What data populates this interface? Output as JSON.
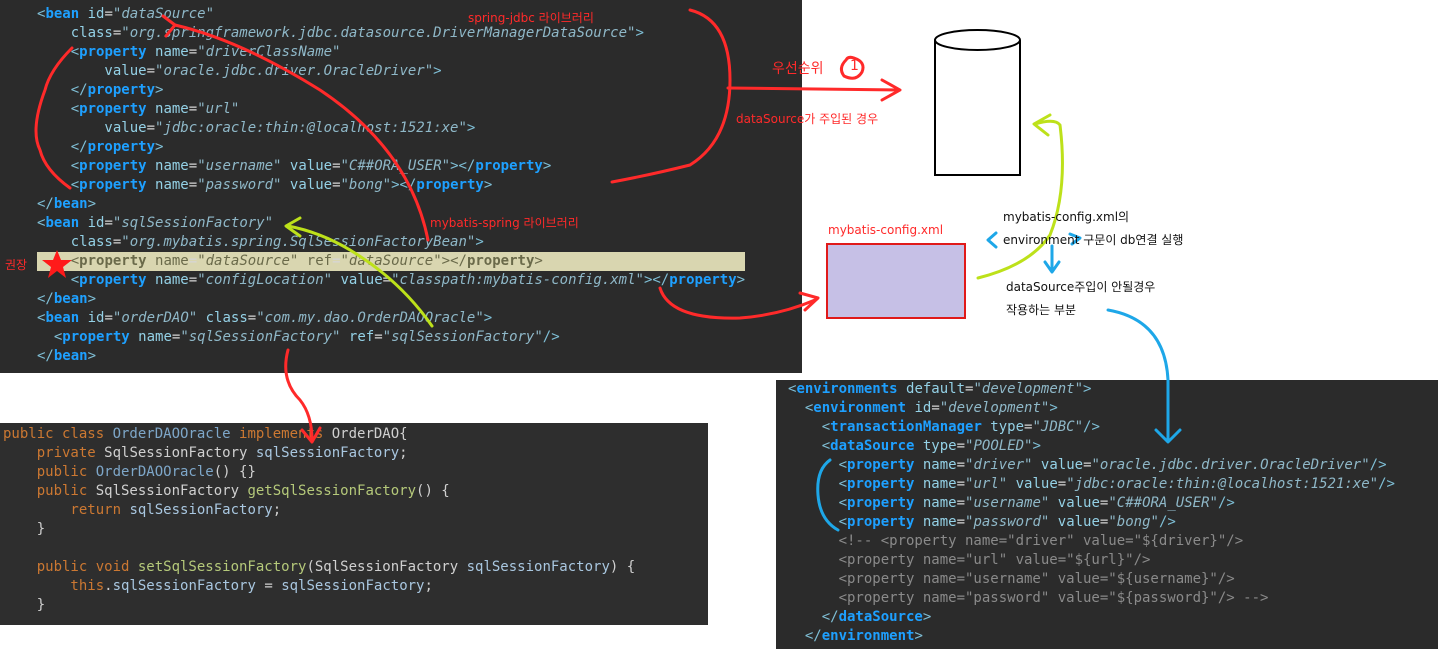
{
  "spring_xml": {
    "lines": [
      [
        [
          "t",
          "<"
        ],
        [
          "k",
          "bean"
        ],
        [
          "a",
          " id"
        ],
        [
          "p",
          "="
        ],
        [
          "v",
          "\"dataSource\""
        ]
      ],
      [
        [
          "a",
          "    class"
        ],
        [
          "p",
          "="
        ],
        [
          "v",
          "\"org.springframework.jdbc.datasource.DriverManagerDataSource\""
        ],
        [
          "t",
          ">"
        ]
      ],
      [
        [
          "t",
          "    <"
        ],
        [
          "k",
          "property"
        ],
        [
          "a",
          " name"
        ],
        [
          "p",
          "="
        ],
        [
          "v",
          "\"driverClassName\""
        ]
      ],
      [
        [
          "a",
          "        value"
        ],
        [
          "p",
          "="
        ],
        [
          "v",
          "\"oracle.jdbc.driver.OracleDriver\""
        ],
        [
          "t",
          ">"
        ]
      ],
      [
        [
          "t",
          "    </"
        ],
        [
          "k",
          "property"
        ],
        [
          "t",
          ">"
        ]
      ],
      [
        [
          "t",
          "    <"
        ],
        [
          "k",
          "property"
        ],
        [
          "a",
          " name"
        ],
        [
          "p",
          "="
        ],
        [
          "v",
          "\"url\""
        ]
      ],
      [
        [
          "a",
          "        value"
        ],
        [
          "p",
          "="
        ],
        [
          "v",
          "\"jdbc:oracle:thin:@localhost:1521:xe\""
        ],
        [
          "t",
          ">"
        ]
      ],
      [
        [
          "t",
          "    </"
        ],
        [
          "k",
          "property"
        ],
        [
          "t",
          ">"
        ]
      ],
      [
        [
          "t",
          "    <"
        ],
        [
          "k",
          "property"
        ],
        [
          "a",
          " name"
        ],
        [
          "p",
          "="
        ],
        [
          "v",
          "\"username\""
        ],
        [
          "a",
          " value"
        ],
        [
          "p",
          "="
        ],
        [
          "v",
          "\"C##ORA_USER\""
        ],
        [
          "t",
          "></"
        ],
        [
          "k",
          "property"
        ],
        [
          "t",
          ">"
        ]
      ],
      [
        [
          "t",
          "    <"
        ],
        [
          "k",
          "property"
        ],
        [
          "a",
          " name"
        ],
        [
          "p",
          "="
        ],
        [
          "v",
          "\"password\""
        ],
        [
          "a",
          " value"
        ],
        [
          "p",
          "="
        ],
        [
          "v",
          "\"bong\""
        ],
        [
          "t",
          "></"
        ],
        [
          "k",
          "property"
        ],
        [
          "t",
          ">"
        ]
      ],
      [
        [
          "t",
          "</"
        ],
        [
          "k",
          "bean"
        ],
        [
          "t",
          ">"
        ]
      ],
      [
        [
          "t",
          "<"
        ],
        [
          "k",
          "bean"
        ],
        [
          "a",
          " id"
        ],
        [
          "p",
          "="
        ],
        [
          "v",
          "\"sqlSessionFactory\""
        ]
      ],
      [
        [
          "a",
          "    class"
        ],
        [
          "p",
          "="
        ],
        [
          "v",
          "\"org.mybatis.spring.SqlSessionFactoryBean\""
        ],
        [
          "t",
          ">"
        ]
      ],
      [
        [
          "t",
          "    <"
        ],
        [
          "k",
          "property"
        ],
        [
          "a",
          " name"
        ],
        [
          "p",
          "="
        ],
        [
          "v",
          "\"dataSource\""
        ],
        [
          "a",
          " ref"
        ],
        [
          "p",
          "="
        ],
        [
          "v",
          "\"dataSource\""
        ],
        [
          "t",
          "></"
        ],
        [
          "k",
          "property"
        ],
        [
          "t",
          ">"
        ]
      ],
      [
        [
          "t",
          "    <"
        ],
        [
          "k",
          "property"
        ],
        [
          "a",
          " name"
        ],
        [
          "p",
          "="
        ],
        [
          "v",
          "\"configLocation\""
        ],
        [
          "a",
          " value"
        ],
        [
          "p",
          "="
        ],
        [
          "v",
          "\"classpath:mybatis-config.xml\""
        ],
        [
          "t",
          "></"
        ],
        [
          "k",
          "property"
        ],
        [
          "t",
          ">"
        ]
      ],
      [
        [
          "t",
          "</"
        ],
        [
          "k",
          "bean"
        ],
        [
          "t",
          ">"
        ]
      ],
      [
        [
          "t",
          "<"
        ],
        [
          "k",
          "bean"
        ],
        [
          "a",
          " id"
        ],
        [
          "p",
          "="
        ],
        [
          "v",
          "\"orderDAO\""
        ],
        [
          "a",
          " class"
        ],
        [
          "p",
          "="
        ],
        [
          "v",
          "\"com.my.dao.OrderDAOOracle\""
        ],
        [
          "t",
          ">"
        ]
      ],
      [
        [
          "t",
          "  <"
        ],
        [
          "k",
          "property"
        ],
        [
          "a",
          " name"
        ],
        [
          "p",
          "="
        ],
        [
          "v",
          "\"sqlSessionFactory\""
        ],
        [
          "a",
          " ref"
        ],
        [
          "p",
          "="
        ],
        [
          "v",
          "\"sqlSessionFactory\""
        ],
        [
          "t",
          "/>"
        ]
      ],
      [
        [
          "t",
          "</"
        ],
        [
          "k",
          "bean"
        ],
        [
          "t",
          ">"
        ]
      ]
    ],
    "highlighted_line": 13
  },
  "java_code": {
    "lines": [
      [
        [
          "jk",
          "public class "
        ],
        [
          "jt",
          "OrderDAOOracle "
        ],
        [
          "jk",
          "implements "
        ],
        [
          "jp",
          "OrderDAO{"
        ]
      ],
      [
        [
          "jk",
          "    private "
        ],
        [
          "jp",
          "SqlSessionFactory "
        ],
        [
          "jv",
          "sqlSessionFactory"
        ],
        [
          "jp",
          ";"
        ]
      ],
      [
        [
          "jk",
          "    public "
        ],
        [
          "jt",
          "OrderDAOOracle"
        ],
        [
          "jp",
          "() {}"
        ]
      ],
      [
        [
          "jk",
          "    public "
        ],
        [
          "jp",
          "SqlSessionFactory "
        ],
        [
          "jm",
          "getSqlSessionFactory"
        ],
        [
          "jp",
          "() {"
        ]
      ],
      [
        [
          "jk",
          "        return "
        ],
        [
          "jv",
          "sqlSessionFactory"
        ],
        [
          "jp",
          ";"
        ]
      ],
      [
        [
          "jp",
          "    }"
        ]
      ],
      [
        [
          "jp",
          " "
        ]
      ],
      [
        [
          "jk",
          "    public void "
        ],
        [
          "jm",
          "setSqlSessionFactory"
        ],
        [
          "jp",
          "(SqlSessionFactory "
        ],
        [
          "jv",
          "sqlSessionFactory"
        ],
        [
          "jp",
          ") {"
        ]
      ],
      [
        [
          "jk",
          "        this"
        ],
        [
          "jp",
          "."
        ],
        [
          "jv",
          "sqlSessionFactory"
        ],
        [
          "jp",
          " = "
        ],
        [
          "jv",
          "sqlSessionFactory"
        ],
        [
          "jp",
          ";"
        ]
      ],
      [
        [
          "jp",
          "    }"
        ]
      ]
    ]
  },
  "mybatis_xml": {
    "lines": [
      [
        [
          "t",
          "<"
        ],
        [
          "k",
          "environments"
        ],
        [
          "a",
          " default"
        ],
        [
          "p",
          "="
        ],
        [
          "v",
          "\"development\""
        ],
        [
          "t",
          ">"
        ]
      ],
      [
        [
          "t",
          "  <"
        ],
        [
          "k",
          "environment"
        ],
        [
          "a",
          " id"
        ],
        [
          "p",
          "="
        ],
        [
          "v",
          "\"development\""
        ],
        [
          "t",
          ">"
        ]
      ],
      [
        [
          "t",
          "    <"
        ],
        [
          "k",
          "transactionManager"
        ],
        [
          "a",
          " type"
        ],
        [
          "p",
          "="
        ],
        [
          "v",
          "\"JDBC\""
        ],
        [
          "t",
          "/>"
        ]
      ],
      [
        [
          "t",
          "    <"
        ],
        [
          "k",
          "dataSource"
        ],
        [
          "a",
          " type"
        ],
        [
          "p",
          "="
        ],
        [
          "v",
          "\"POOLED\""
        ],
        [
          "t",
          ">"
        ]
      ],
      [
        [
          "t",
          "      <"
        ],
        [
          "k",
          "property"
        ],
        [
          "a",
          " name"
        ],
        [
          "p",
          "="
        ],
        [
          "v",
          "\"driver\""
        ],
        [
          "a",
          " value"
        ],
        [
          "p",
          "="
        ],
        [
          "v",
          "\"oracle.jdbc.driver.OracleDriver\""
        ],
        [
          "t",
          "/>"
        ]
      ],
      [
        [
          "t",
          "      <"
        ],
        [
          "k",
          "property"
        ],
        [
          "a",
          " name"
        ],
        [
          "p",
          "="
        ],
        [
          "v",
          "\"url\""
        ],
        [
          "a",
          " value"
        ],
        [
          "p",
          "="
        ],
        [
          "v",
          "\"jdbc:oracle:thin:@localhost:1521:xe\""
        ],
        [
          "t",
          "/>"
        ]
      ],
      [
        [
          "t",
          "      <"
        ],
        [
          "k",
          "property"
        ],
        [
          "a",
          " name"
        ],
        [
          "p",
          "="
        ],
        [
          "v",
          "\"username\""
        ],
        [
          "a",
          " value"
        ],
        [
          "p",
          "="
        ],
        [
          "v",
          "\"C##ORA_USER\""
        ],
        [
          "t",
          "/>"
        ]
      ],
      [
        [
          "t",
          "      <"
        ],
        [
          "k",
          "property"
        ],
        [
          "a",
          " name"
        ],
        [
          "p",
          "="
        ],
        [
          "v",
          "\"password\""
        ],
        [
          "a",
          " value"
        ],
        [
          "p",
          "="
        ],
        [
          "v",
          "\"bong\""
        ],
        [
          "t",
          "/>"
        ]
      ],
      [
        [
          "c",
          "      <!-- <property name=\"driver\" value=\"${driver}\"/>"
        ]
      ],
      [
        [
          "c",
          "      <property name=\"url\" value=\"${url}\"/>"
        ]
      ],
      [
        [
          "c",
          "      <property name=\"username\" value=\"${username}\"/>"
        ]
      ],
      [
        [
          "c",
          "      <property name=\"password\" value=\"${password}\"/> -->"
        ]
      ],
      [
        [
          "t",
          "    </"
        ],
        [
          "k",
          "dataSource"
        ],
        [
          "t",
          ">"
        ]
      ],
      [
        [
          "t",
          "  </"
        ],
        [
          "k",
          "environment"
        ],
        [
          "t",
          ">"
        ]
      ]
    ]
  },
  "annotations": {
    "spring_jdbc": "spring-jdbc 라이브러리",
    "mybatis_spring": "mybatis-spring 라이브러리",
    "priority": "우선순위",
    "priority_mark": "1",
    "datasource_injected": "dataSource가 주입된 경우",
    "recommended": "권장",
    "mybatis_config": "mybatis-config.xml",
    "env_line1": "mybatis-config.xml의",
    "env_line2": "environment 구문이 db연결 실행",
    "no_inject_line1": "dataSource주입이 안될경우",
    "no_inject_line2": "작용하는 부분"
  },
  "colors": {
    "panel_bg": "#2b2b2b",
    "annotation_red": "#ff2a2a",
    "annotation_blue": "#1ea7e8",
    "annotation_green": "#bde11a",
    "config_box_fill": "#c6c0e6"
  }
}
